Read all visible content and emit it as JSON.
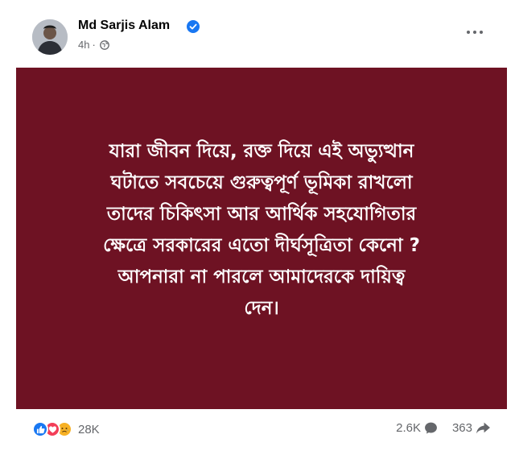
{
  "post": {
    "author": "Md Sarjis Alam",
    "time": "4h",
    "separator": "·",
    "body_lines": [
      "যারা জীবন দিয়ে, রক্ত দিয়ে এই অভ্যুত্থান",
      "ঘটাতে সবচেয়ে গুরুত্বপূর্ণ ভূমিকা রাখলো",
      "তাদের চিকিৎসা আর আর্থিক সহযোগিতার",
      "ক্ষেত্রে সরকারের এতো দীর্ঘসূত্রিতা কেনো ?",
      "আপনারা না পারলে আমাদেরকে দায়িত্ব",
      "দেন।"
    ],
    "background_color": "#6e1223"
  },
  "footer": {
    "reaction_count": "28K",
    "comment_count": "2.6K",
    "share_count": "363",
    "reaction_icons": [
      "like-icon",
      "love-icon",
      "sad-icon"
    ]
  },
  "icons": {
    "verified": "verified-badge-icon",
    "globe": "globe-icon",
    "more": "more-options-icon",
    "comment": "comment-icon",
    "share": "share-icon"
  },
  "colors": {
    "accent": "#1877f2",
    "secondary_text": "#65676b"
  }
}
